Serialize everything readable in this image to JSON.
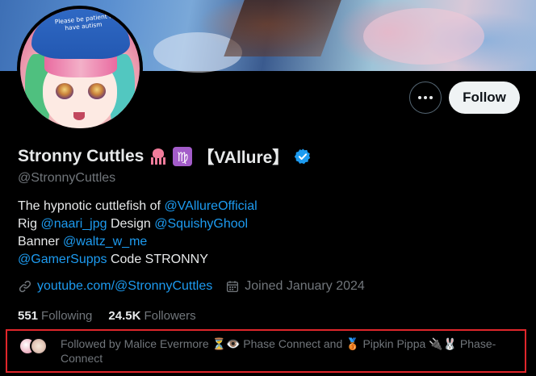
{
  "profile": {
    "display_name": "Stronny Cuttles",
    "name_suffix": "【VAllure】",
    "name_emojis": [
      "squid-emoji",
      "virgo-emoji"
    ],
    "virgo_glyph": "♍",
    "handle": "@StronnyCuttles",
    "avatar_cap_text": "Please be patient I have autism"
  },
  "actions": {
    "follow_label": "Follow"
  },
  "bio": {
    "line1_prefix": "The hypnotic cuttlefish of ",
    "line1_link": "@VAllureOfficial",
    "line2_prefix": "Rig ",
    "line2_link1": "@naari_jpg",
    "line2_mid": " Design ",
    "line2_link2": "@SquishyGhool",
    "line3_prefix": "Banner ",
    "line3_link": "@waltz_w_me",
    "line4_link": "@GamerSupps",
    "line4_suffix": " Code STRONNY"
  },
  "meta": {
    "website": "youtube.com/@StronnyCuttles",
    "joined": "Joined January 2024"
  },
  "stats": {
    "following_count": "551",
    "following_label": "Following",
    "followers_count": "24.5K",
    "followers_label": "Followers"
  },
  "followed_by": {
    "text": "Followed by Malice Evermore ⏳👁️ Phase Connect and 🥉 Pipkin Pippa 🔌🐰 Phase-Connect"
  },
  "colors": {
    "accent": "#1d9bf0",
    "highlight_border": "#e0262b",
    "muted_text": "#71767b"
  }
}
